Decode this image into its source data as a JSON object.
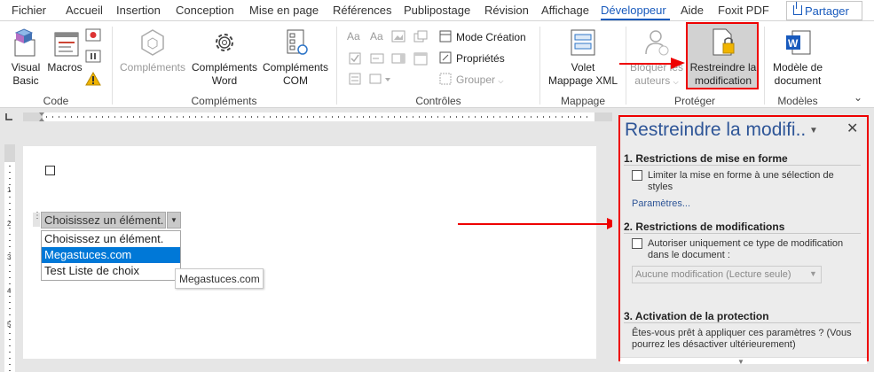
{
  "menu": {
    "tabs": [
      "Fichier",
      "Accueil",
      "Insertion",
      "Conception",
      "Mise en page",
      "Références",
      "Publipostage",
      "Révision",
      "Affichage",
      "Développeur",
      "Aide",
      "Foxit PDF"
    ],
    "active_tab": "Développeur",
    "share_label": "Partager"
  },
  "ribbon": {
    "code": {
      "visual_basic": [
        "Visual",
        "Basic"
      ],
      "macros": "Macros",
      "group": "Code"
    },
    "complements": {
      "complements": "Compléments",
      "complements_word": [
        "Compléments",
        "Word"
      ],
      "complements_com": [
        "Compléments",
        "COM"
      ],
      "group": "Compléments"
    },
    "controles": {
      "mode_creation": "Mode Création",
      "proprietes": "Propriétés",
      "grouper": "Grouper",
      "group": "Contrôles"
    },
    "mappage": {
      "volet": [
        "Volet",
        "Mappage XML"
      ],
      "group": "Mappage"
    },
    "proteger": {
      "bloquer": [
        "Bloquer les",
        "auteurs"
      ],
      "restreindre": [
        "Restreindre la",
        "modification"
      ],
      "group": "Protéger"
    },
    "modeles": {
      "modele": [
        "Modèle de",
        "document"
      ],
      "group": "Modèles"
    },
    "accent": "#185abd",
    "highlight_color": "#e00000"
  },
  "document": {
    "content_control_value": "Choisissez un élément.",
    "dropdown_options": [
      "Choisissez un élément.",
      "Megastuces.com",
      "Test Liste de choix"
    ],
    "selected_option": "Megastuces.com",
    "tooltip": "Megastuces.com",
    "ruler_v_labels": [
      "1",
      "2",
      "3",
      "4",
      "5"
    ]
  },
  "panel": {
    "title": "Restreindre la modifi..",
    "section1": {
      "heading": "1. Restrictions de mise en forme",
      "checkbox_label": "Limiter la mise en forme à une sélection de styles",
      "link": "Paramètres..."
    },
    "section2": {
      "heading": "2. Restrictions de modifications",
      "checkbox_label": "Autoriser uniquement ce type de modification dans le document :",
      "select_value": "Aucune modification (Lecture seule)"
    },
    "section3": {
      "heading": "3. Activation de la protection",
      "text": "Êtes-vous prêt à appliquer ces paramètres ? (Vous pourrez les désactiver ultérieurement)"
    },
    "title_color": "#2e5597"
  }
}
